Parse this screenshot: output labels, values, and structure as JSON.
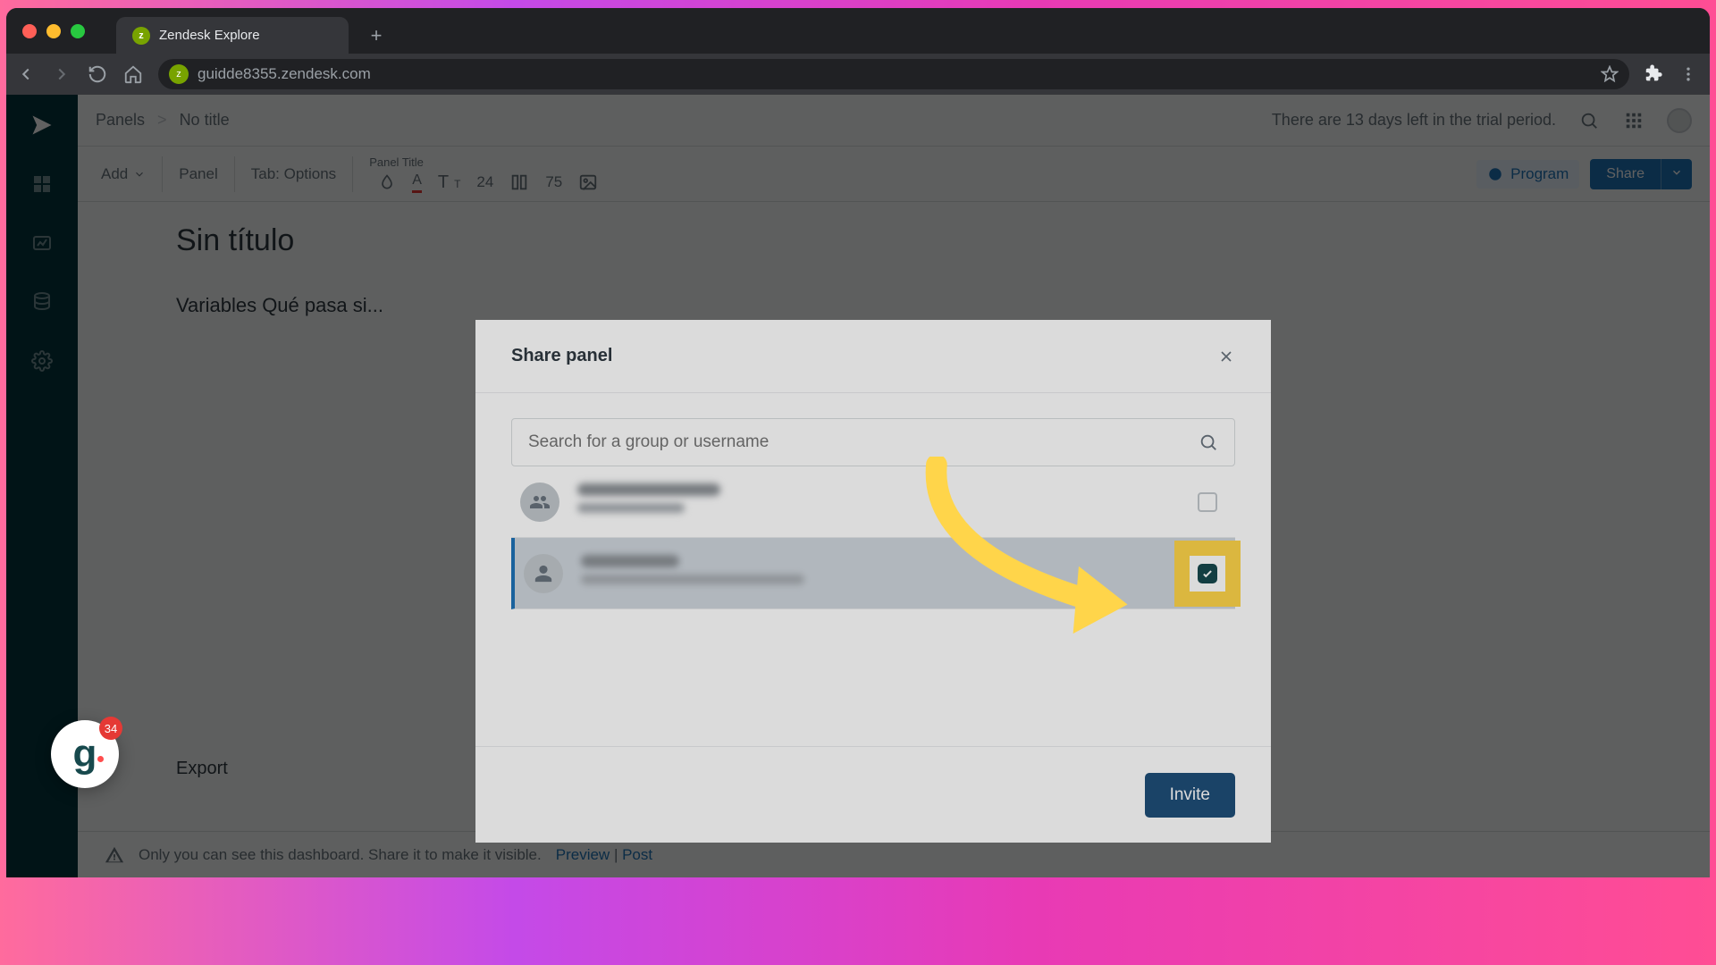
{
  "browser": {
    "tab_title": "Zendesk Explore",
    "url": "guidde8355.zendesk.com"
  },
  "header": {
    "breadcrumb_root": "Panels",
    "breadcrumb_sep": ">",
    "breadcrumb_current": "No title",
    "trial_text": "There are 13 days left in the trial period."
  },
  "toolbar": {
    "add_label": "Add",
    "panel_label": "Panel",
    "tab_label": "Tab: Options",
    "panel_title_label": "Panel Title",
    "font_size": "24",
    "col_val": "75",
    "program_label": "Program",
    "share_label": "Share"
  },
  "canvas": {
    "page_title": "Sin título",
    "section_title": "Variables Qué pasa si...",
    "export_label": "Export"
  },
  "footer": {
    "message": "Only you can see this dashboard. Share it to make it visible.",
    "preview": "Preview",
    "sep": "|",
    "post": "Post"
  },
  "modal": {
    "title": "Share panel",
    "search_placeholder": "Search for a group or username",
    "invite_label": "Invite"
  },
  "guidde": {
    "count": "34"
  }
}
